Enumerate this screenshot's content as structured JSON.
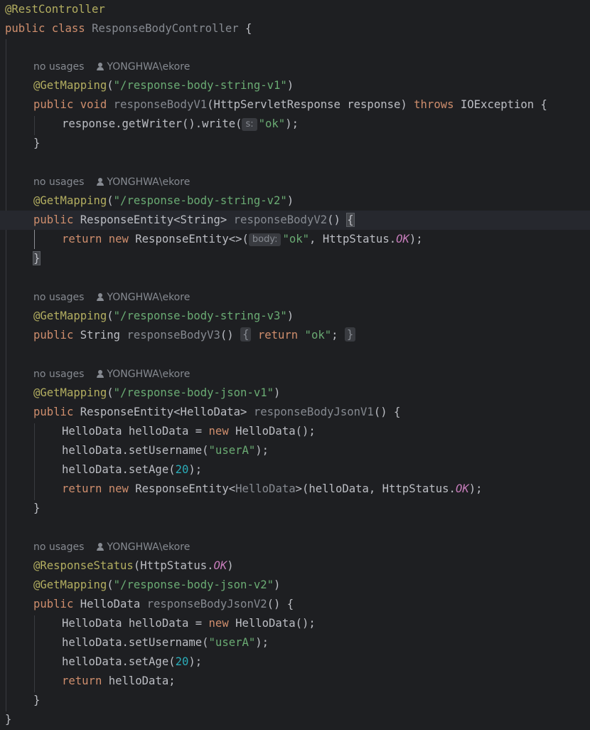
{
  "editor": {
    "language": "java",
    "usage_hint": {
      "text": "no usages",
      "author": "YONGHWA\\ekore",
      "icon": "user-icon"
    },
    "lines": {
      "class_annotation": "@RestController",
      "class_decl_kw": "public class",
      "class_name": "ResponseBodyController",
      "class_open": " {",
      "class_close": "}",
      "m1": {
        "ann": "@GetMapping",
        "path": "\"/response-body-string-v1\"",
        "kw": "public void",
        "name": "responseBodyV1",
        "params": "(HttpServletResponse response) ",
        "throws": "throws",
        "exc": " IOException {",
        "body1_a": "response.getWriter().write(",
        "hint": "s:",
        "body1_str": "\"ok\"",
        "body1_b": ");",
        "close": "}"
      },
      "m2": {
        "ann": "@GetMapping",
        "path": "\"/response-body-string-v2\"",
        "kw": "public",
        "type": " ResponseEntity<String> ",
        "name": "responseBodyV2",
        "sig_end": "() ",
        "open": "{",
        "ret": "return new",
        "body_a": " ResponseEntity<>(",
        "hint": "body:",
        "body_str": "\"ok\"",
        "body_b": ", HttpStatus.",
        "ok": "OK",
        "body_c": ");",
        "close": "}"
      },
      "m3": {
        "ann": "@GetMapping",
        "path": "\"/response-body-string-v3\"",
        "kw": "public",
        "type": " String ",
        "name": "responseBodyV3",
        "sig_end": "() ",
        "open": "{",
        "ret": " return",
        "str": " \"ok\"",
        "semi": "; ",
        "close": "}"
      },
      "m4": {
        "ann": "@GetMapping",
        "path": "\"/response-body-json-v1\"",
        "kw": "public",
        "type": " ResponseEntity<HelloData> ",
        "name": "responseBodyJsonV1",
        "sig_end": "() {",
        "l1_a": "HelloData helloData = ",
        "l1_new": "new",
        "l1_b": " HelloData();",
        "l2_a": "helloData.setUsername(",
        "l2_str": "\"userA\"",
        "l2_b": ");",
        "l3_a": "helloData.setAge(",
        "l3_num": "20",
        "l3_b": ");",
        "l4_ret": "return new",
        "l4_a": " ResponseEntity<",
        "l4_dim": "HelloData",
        "l4_b": ">(helloData, HttpStatus.",
        "ok": "OK",
        "l4_c": ");",
        "close": "}"
      },
      "m5": {
        "ann_status": "@ResponseStatus",
        "status_a": "(HttpStatus.",
        "ok": "OK",
        "status_b": ")",
        "ann": "@GetMapping",
        "path": "\"/response-body-json-v2\"",
        "kw": "public",
        "type": " HelloData ",
        "name": "responseBodyJsonV2",
        "sig_end": "() {",
        "l1_a": "HelloData helloData = ",
        "l1_new": "new",
        "l1_b": " HelloData();",
        "l2_a": "helloData.setUsername(",
        "l2_str": "\"userA\"",
        "l2_b": ");",
        "l3_a": "helloData.setAge(",
        "l3_num": "20",
        "l3_b": ");",
        "l4_ret": "return",
        "l4_a": " helloData;",
        "close": "}"
      }
    }
  }
}
